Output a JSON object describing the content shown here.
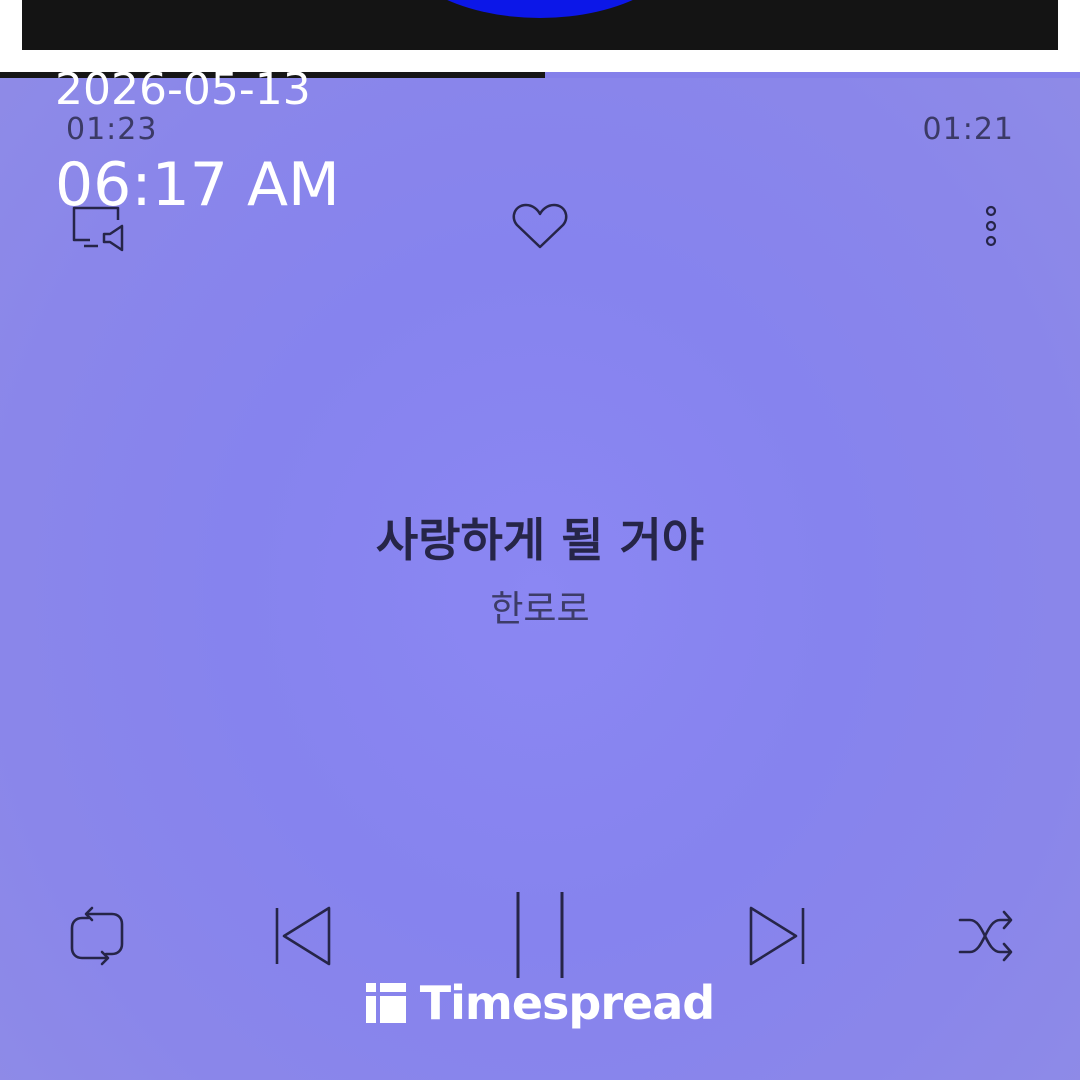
{
  "player": {
    "progress_fraction": 0.505,
    "time_elapsed": "01:23",
    "time_remaining": "01:21"
  },
  "timestamp": {
    "date": "2026-05-13",
    "time": "06:17 AM"
  },
  "track": {
    "title": "사랑하게 될 거야",
    "artist": "한로로"
  },
  "watermark": {
    "label": "Timespread"
  },
  "icons": {
    "cast": "cast-icon",
    "like": "heart-icon",
    "more": "more-vertical-icon",
    "repeat": "repeat-icon",
    "previous": "skip-previous-icon",
    "pause": "pause-icon",
    "next": "skip-next-icon",
    "shuffle": "shuffle-icon",
    "brand": "timespread-logo-icon"
  },
  "colors": {
    "background": "#8683ee",
    "album_accent": "#0c17e8",
    "icon_stroke": "#262548",
    "progress_fill": "#161616"
  }
}
